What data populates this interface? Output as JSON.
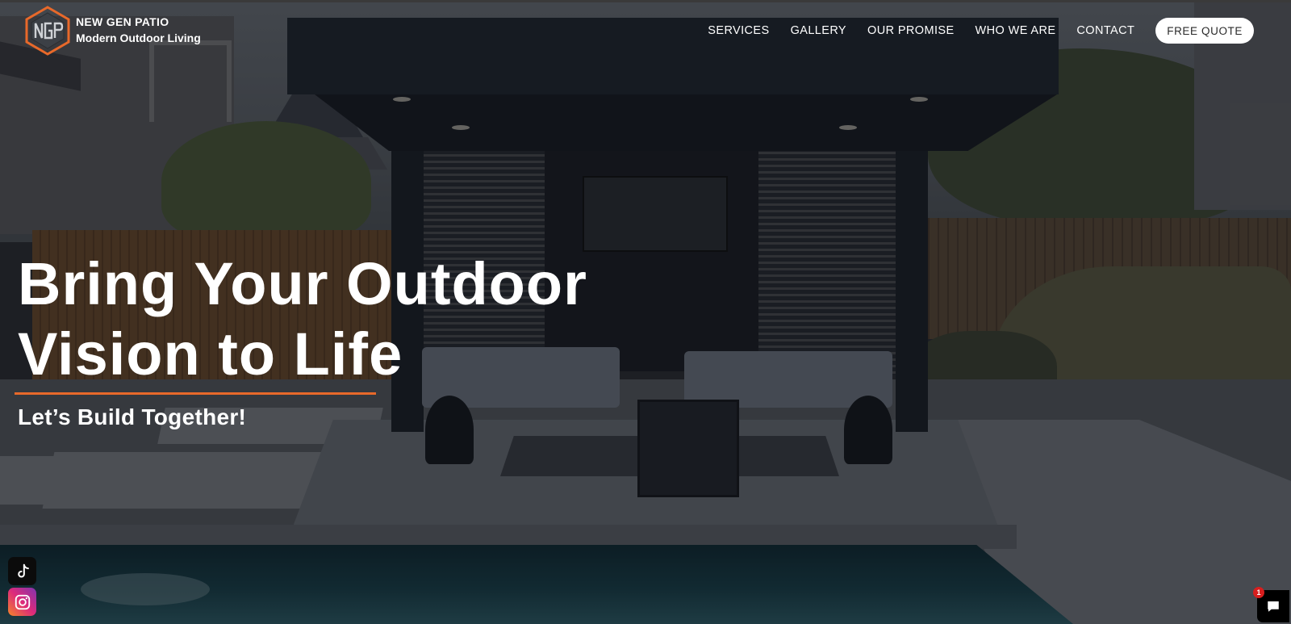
{
  "brand": {
    "name": "NEW GEN PATIO",
    "tagline": "Modern Outdoor Living",
    "logo_icon": "ngp-hexagon-logo",
    "accent_color": "#e8692a"
  },
  "nav": {
    "items": [
      {
        "label": "SERVICES"
      },
      {
        "label": "GALLERY"
      },
      {
        "label": "OUR PROMISE"
      },
      {
        "label": "WHO WE ARE"
      },
      {
        "label": "CONTACT"
      }
    ],
    "cta_label": "FREE QUOTE"
  },
  "hero": {
    "line1": "Bring Your Outdoor",
    "line2": "Vision to Life",
    "subtitle": "Let’s Build Together!",
    "background": "modern pavilion with louvered walls, outdoor seating and pool"
  },
  "social": [
    {
      "icon": "tiktok-icon"
    },
    {
      "icon": "instagram-icon"
    }
  ],
  "chat": {
    "icon": "chat-bubble-icon",
    "badge_count": "1"
  }
}
